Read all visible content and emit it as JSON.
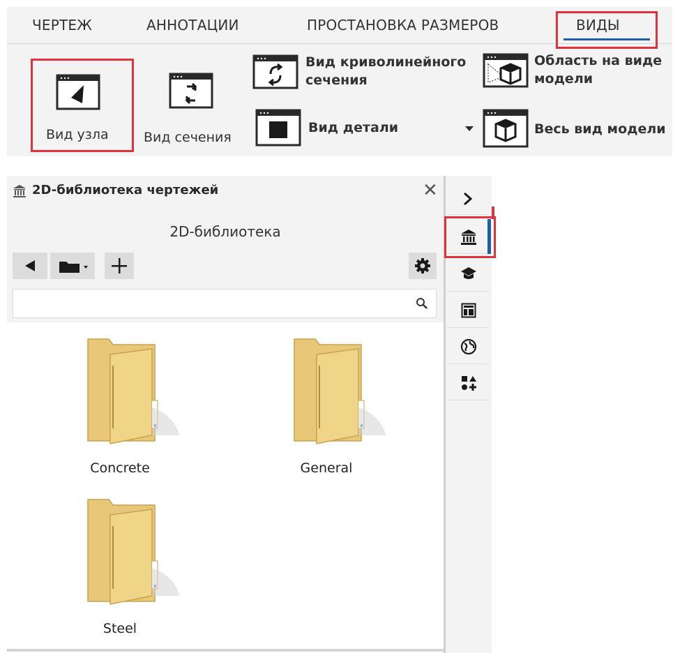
{
  "ribbon": {
    "tabs": [
      "ЧЕРТЕЖ",
      "АННОТАЦИИ",
      "ПРОСТАНОВКА РАЗМЕРОВ",
      "ВИДЫ"
    ],
    "active_tab": "ВИДЫ",
    "buttons": {
      "node_view": "Вид узла",
      "section_view": "Вид сечения",
      "curved_section_line1": "Вид криволинейного",
      "curved_section_line2": "сечения",
      "detail_view": "Вид детали",
      "model_area_line1": "Область на виде",
      "model_area_line2": "модели",
      "full_model_view": "Весь вид модели"
    },
    "highlight_color": "#e0323a",
    "accent_color": "#1f5ea8"
  },
  "library": {
    "title": "2D-библиотека чертежей",
    "subtitle": "2D-библиотека",
    "search": {
      "value": "",
      "placeholder": ""
    },
    "folders": [
      "Concrete",
      "General",
      "Steel"
    ],
    "toolbar_icons": [
      "back-arrow-icon",
      "folder-dropdown-icon",
      "plus-icon",
      "gear-icon"
    ]
  },
  "side_strip": {
    "icons": [
      "chevron-right-icon",
      "library-icon",
      "graduation-cap-icon",
      "layout-icon",
      "globe-icon",
      "shapes-icon"
    ],
    "active": "library-icon"
  }
}
